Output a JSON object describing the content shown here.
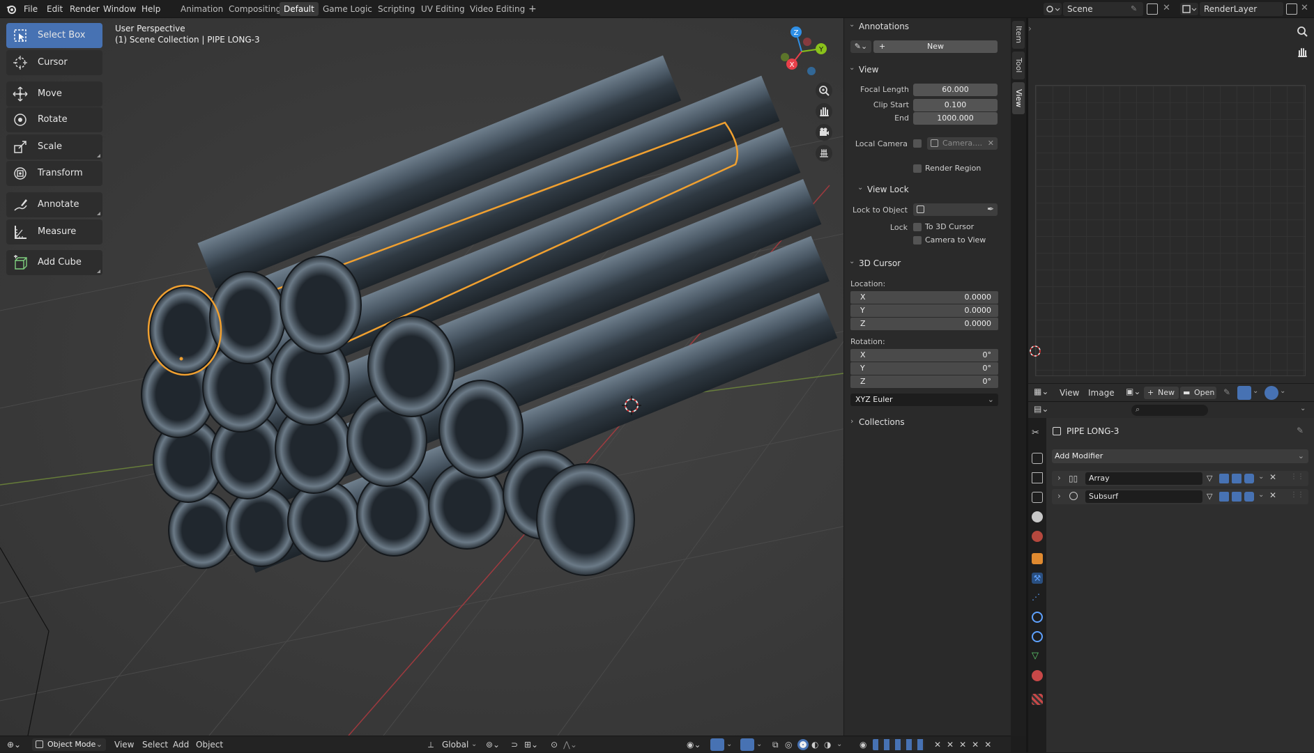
{
  "menu": {
    "file": "File",
    "edit": "Edit",
    "render": "Render",
    "window": "Window",
    "help": "Help"
  },
  "workspaces": [
    "Animation",
    "Compositing",
    "Default",
    "Game Logic",
    "Scripting",
    "UV Editing",
    "Video Editing"
  ],
  "workspace_add": "+",
  "scene": {
    "scene_name": "Scene",
    "view_layer": "RenderLayer"
  },
  "viewport": {
    "perspective_label": "User Perspective",
    "collection_label": "(1) Scene Collection | PIPE LONG-3",
    "gizmo": {
      "x": "X",
      "y": "Y",
      "z": "Z"
    }
  },
  "tools": [
    {
      "label": "Select Box",
      "icon": "select-box-icon"
    },
    {
      "label": "Cursor",
      "icon": "cursor-icon"
    },
    {
      "label": "Move",
      "icon": "move-icon"
    },
    {
      "label": "Rotate",
      "icon": "rotate-icon"
    },
    {
      "label": "Scale",
      "icon": "scale-icon"
    },
    {
      "label": "Transform",
      "icon": "transform-icon"
    },
    {
      "label": "Annotate",
      "icon": "annotate-icon"
    },
    {
      "label": "Measure",
      "icon": "measure-icon"
    },
    {
      "label": "Add Cube",
      "icon": "add-cube-icon"
    }
  ],
  "npanel": {
    "annotations": {
      "title": "Annotations",
      "new_label": "New"
    },
    "view": {
      "title": "View",
      "focal_length_label": "Focal Length",
      "focal_length": "60.000",
      "clip_start_label": "Clip Start",
      "clip_start": "0.100",
      "end_label": "End",
      "end": "1000.000",
      "local_camera_label": "Local Camera",
      "local_camera_placeholder": "Camera....",
      "render_region_label": "Render Region"
    },
    "view_lock": {
      "title": "View Lock",
      "lock_to_object_label": "Lock to Object",
      "lock_label": "Lock",
      "to_3d_cursor": "To 3D Cursor",
      "camera_to_view": "Camera to View"
    },
    "cursor3d": {
      "title": "3D Cursor",
      "location_label": "Location:",
      "location": [
        {
          "axis": "X",
          "value": "0.0000"
        },
        {
          "axis": "Y",
          "value": "0.0000"
        },
        {
          "axis": "Z",
          "value": "0.0000"
        }
      ],
      "rotation_label": "Rotation:",
      "rotation": [
        {
          "axis": "X",
          "value": "0°"
        },
        {
          "axis": "Y",
          "value": "0°"
        },
        {
          "axis": "Z",
          "value": "0°"
        }
      ],
      "rotation_mode": "XYZ Euler"
    },
    "collections": {
      "title": "Collections"
    },
    "tabs": [
      "Item",
      "Tool",
      "View"
    ]
  },
  "image_editor": {
    "view_menu": "View",
    "image_menu": "Image",
    "new_label": "New",
    "open_label": "Open"
  },
  "properties": {
    "object_name": "PIPE LONG-3",
    "add_modifier": "Add Modifier",
    "modifiers": [
      {
        "name": "Array"
      },
      {
        "name": "Subsurf"
      }
    ]
  },
  "viewport_header": {
    "mode": "Object Mode",
    "view": "View",
    "select": "Select",
    "add": "Add",
    "object": "Object",
    "orientation": "Global"
  },
  "colors": {
    "accent": "#4772b3",
    "selection_outline": "#f0a030",
    "axis_x": "#e8404a",
    "axis_y": "#8ac21b",
    "axis_z": "#2f8fe6",
    "pipe": "#4a5763"
  }
}
